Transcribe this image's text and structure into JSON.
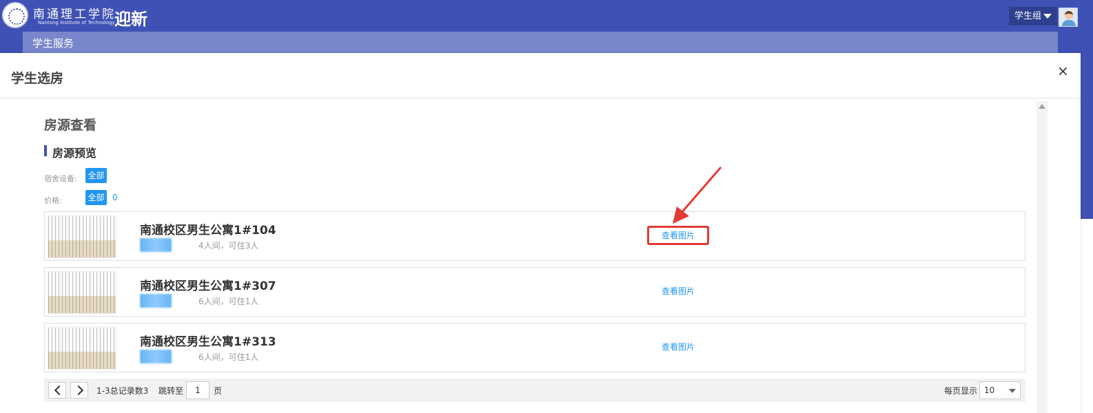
{
  "header": {
    "school_cn": "南通理工学院",
    "school_en": "Nantong Institute of Technology",
    "app_name": "迎新",
    "group_label": "学生组"
  },
  "nav": {
    "items": [
      "学生服务"
    ]
  },
  "modal": {
    "title": "学生选房",
    "close_glyph": "×"
  },
  "page": {
    "heading": "房源查看",
    "section_title": "房源预览",
    "filters": [
      {
        "label": "宿舍设备:",
        "button": "全部"
      },
      {
        "label": "价格:",
        "button": "全部",
        "extra": "0"
      }
    ]
  },
  "rooms": [
    {
      "name": "南通校区男生公寓1#104",
      "capacity": "4人间，可住3人",
      "action": "查看图片",
      "highlighted": true
    },
    {
      "name": "南通校区男生公寓1#307",
      "capacity": "6人间，可住1人",
      "action": "查看图片",
      "highlighted": false
    },
    {
      "name": "南通校区男生公寓1#313",
      "capacity": "6人间，可住1人",
      "action": "查看图片",
      "highlighted": false
    }
  ],
  "pagination": {
    "summary": "1-3总记录数3",
    "jump_label": "跳转至",
    "page_value": "1",
    "page_suffix": "页",
    "per_page_label": "每页显示",
    "per_page_value": "10"
  },
  "colors": {
    "brand": "#3f51b5",
    "nav": "#7986cb",
    "link": "#2196f3",
    "highlight": "#e53935"
  }
}
